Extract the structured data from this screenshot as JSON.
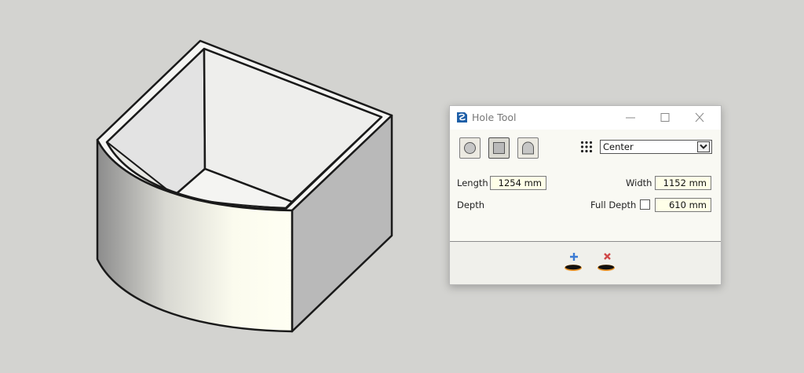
{
  "dialog": {
    "title": "Hole Tool",
    "placement": {
      "label": "Center"
    },
    "length": {
      "label": "Length",
      "value": "1254 mm"
    },
    "width": {
      "label": "Width",
      "value": "1152 mm"
    },
    "depth": {
      "label": "Depth",
      "full_depth_label": "Full Depth",
      "full_depth_checked": false,
      "value": "610 mm"
    }
  },
  "colors": {
    "canvas_background": "#d3d3d0",
    "dialog_background": "#f9f9f3",
    "field_background": "#ffffe8",
    "add_accent": "#3b7bd4",
    "remove_accent": "#d04848",
    "hole_orange": "#e6922a"
  }
}
